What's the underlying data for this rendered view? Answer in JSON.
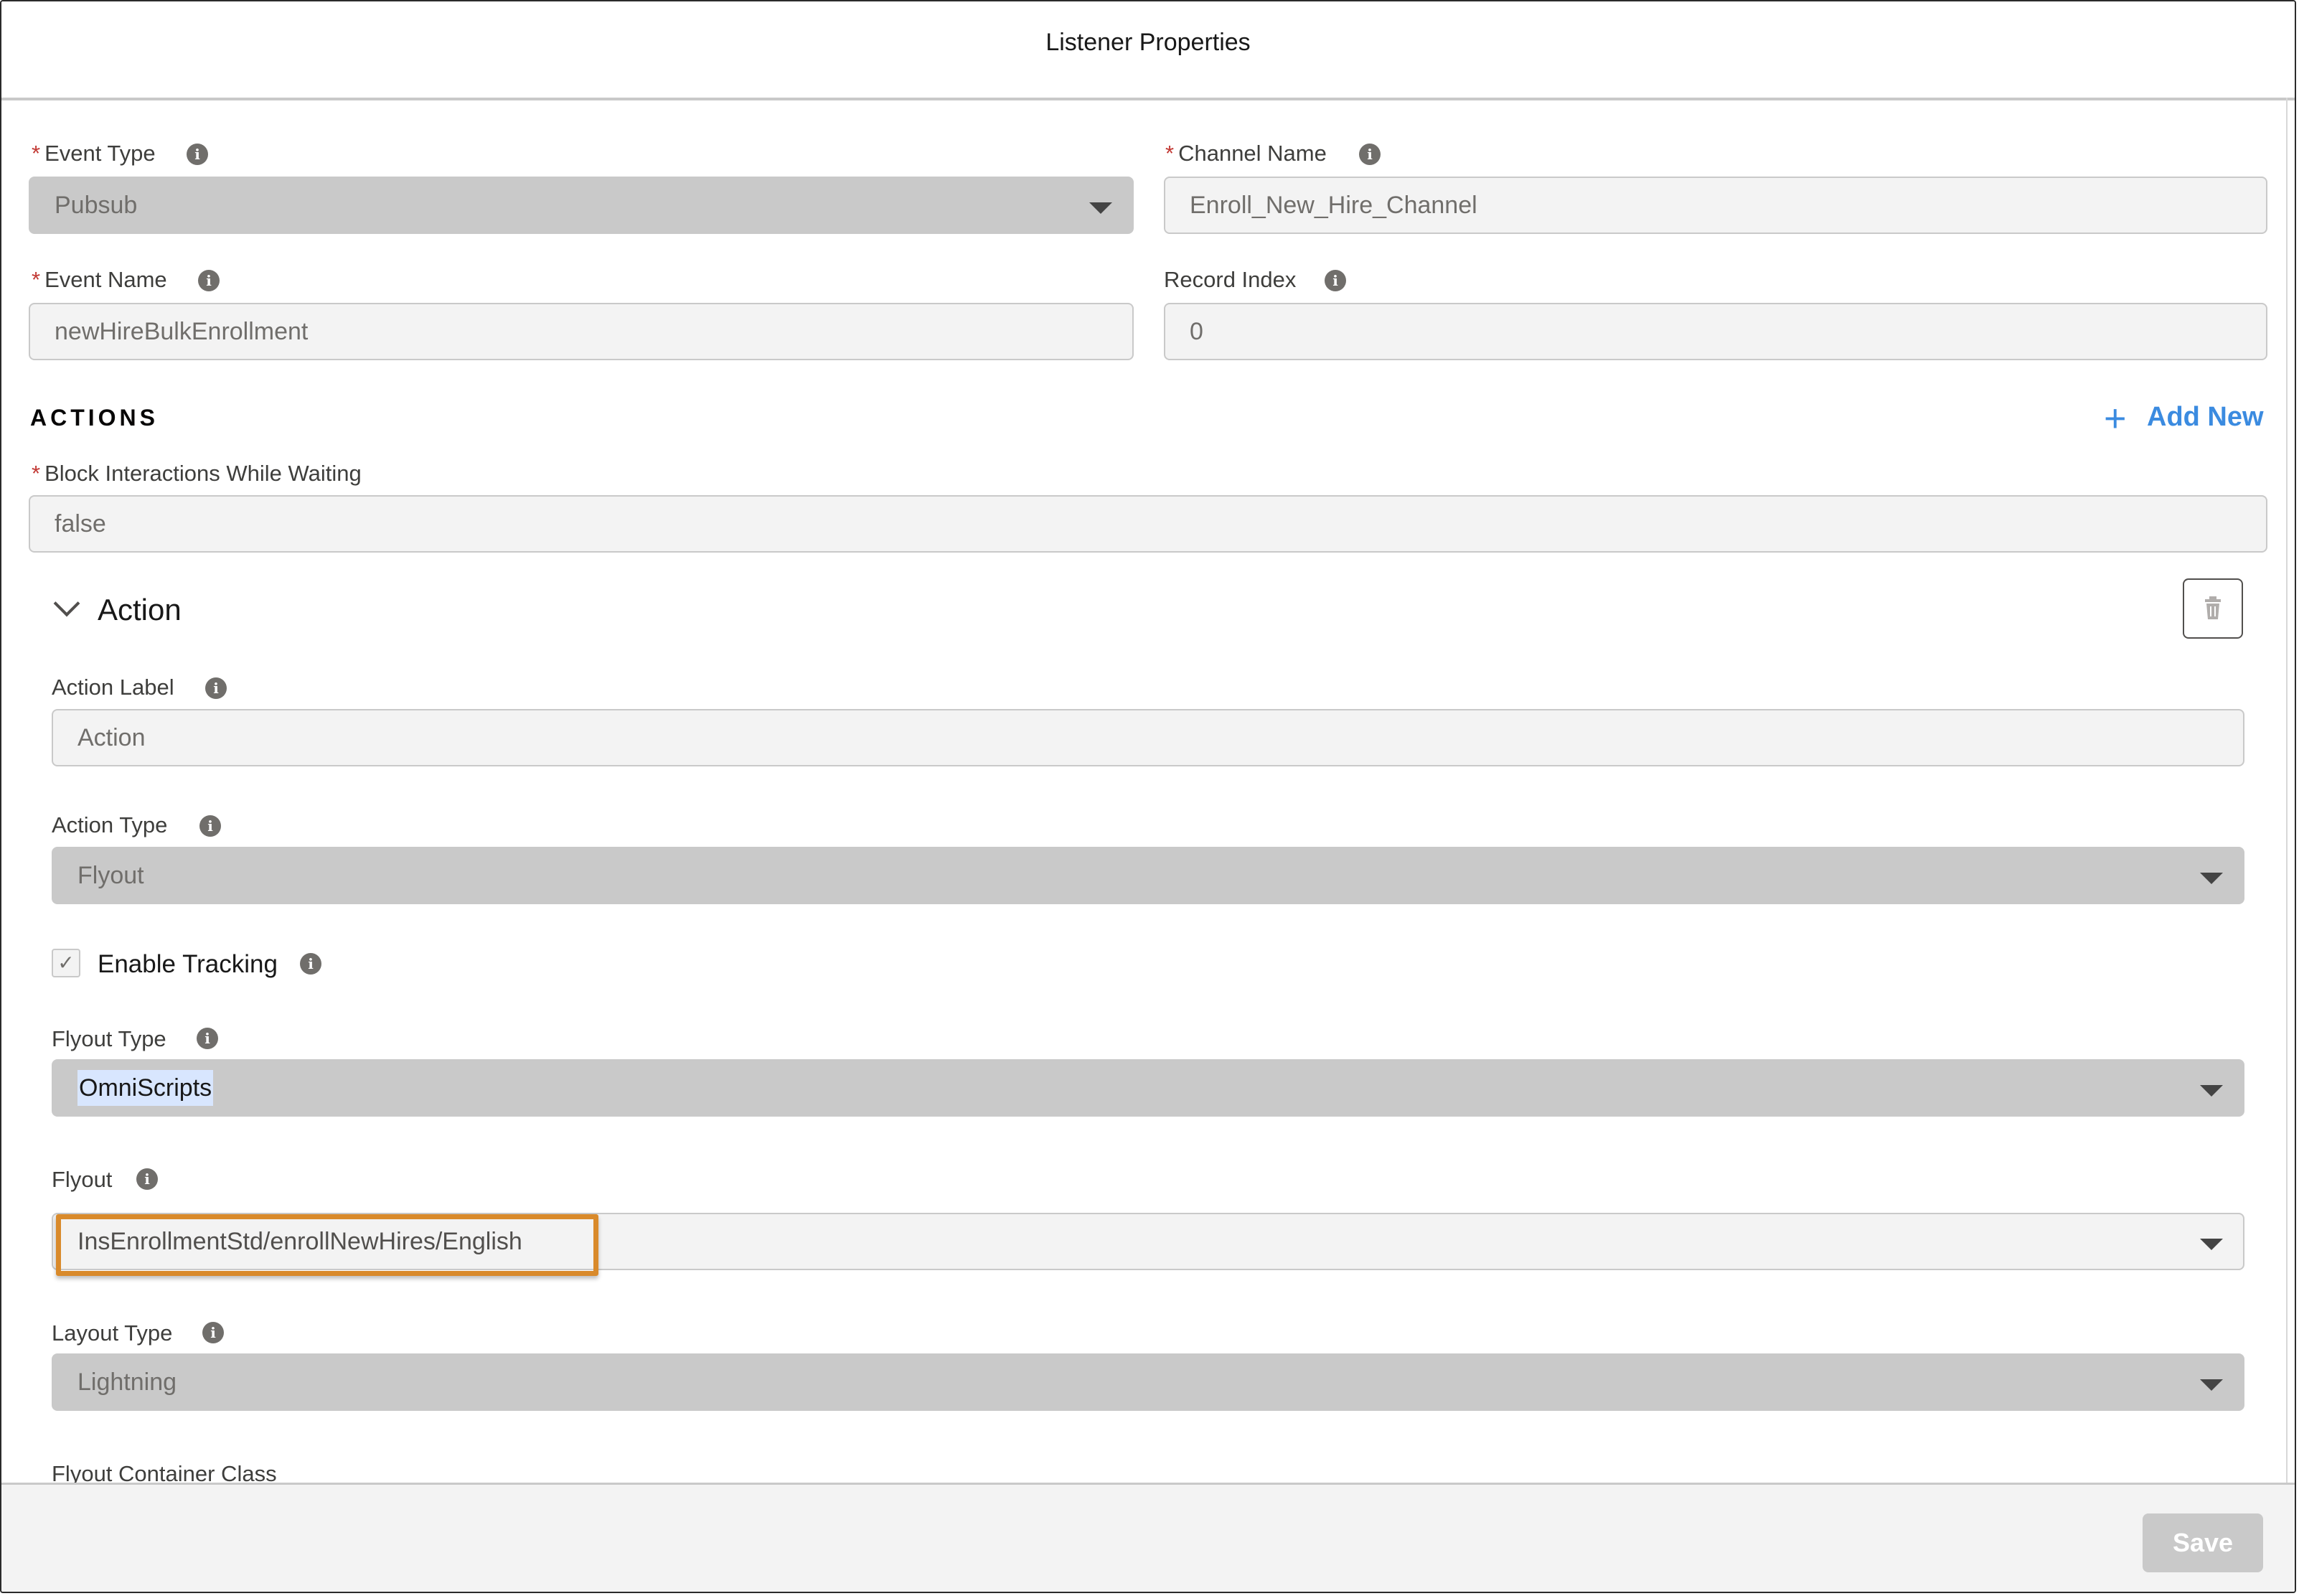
{
  "header": {
    "title": "Listener Properties"
  },
  "event_type": {
    "label": "Event Type",
    "value": "Pubsub"
  },
  "channel_name": {
    "label": "Channel Name",
    "value": "Enroll_New_Hire_Channel"
  },
  "event_name": {
    "label": "Event Name",
    "value": "newHireBulkEnrollment"
  },
  "record_index": {
    "label": "Record Index",
    "value": "0"
  },
  "actions": {
    "title": "ACTIONS",
    "add_new": "Add New",
    "block_label": "Block Interactions While Waiting",
    "block_value": "false"
  },
  "action": {
    "title": "Action",
    "label_label": "Action Label",
    "label_value": "Action",
    "type_label": "Action Type",
    "type_value": "Flyout",
    "tracking_label": "Enable Tracking",
    "tracking_checked": true,
    "flyout_type_label": "Flyout Type",
    "flyout_type_value": "OmniScripts",
    "flyout_label": "Flyout",
    "flyout_value": "InsEnrollmentStd/enrollNewHires/English",
    "layout_type_label": "Layout Type",
    "layout_type_value": "Lightning",
    "container_class_label": "Flyout Container Class"
  },
  "footer": {
    "save_label": "Save"
  },
  "colors": {
    "required": "#c23934",
    "link": "#3b8be0",
    "highlight": "#d98a2b",
    "info_icon": "#706e6b"
  }
}
